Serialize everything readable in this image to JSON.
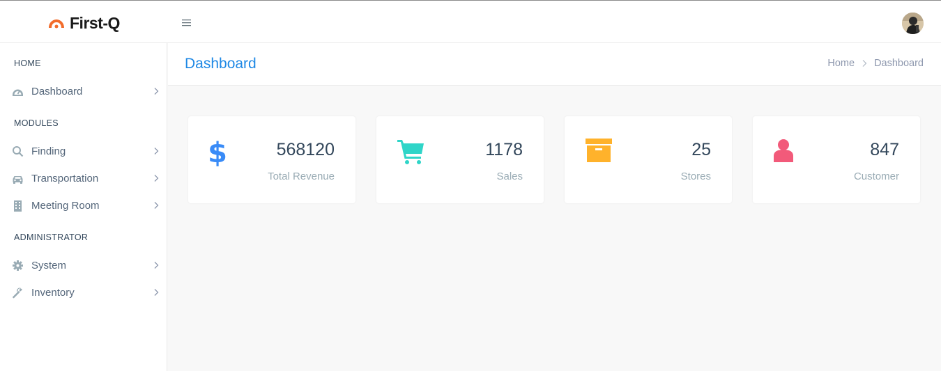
{
  "app": {
    "brand": "First-Q",
    "brand_color": "#f26c2b"
  },
  "topbar": {
    "menu_icon": "hamburger-icon",
    "avatar": "user-avatar"
  },
  "sidebar": {
    "sections": [
      {
        "title": "HOME"
      },
      {
        "title": "MODULES"
      },
      {
        "title": "ADMINISTRATOR"
      }
    ],
    "items": [
      {
        "label": "Dashboard",
        "icon": "gauge-icon"
      },
      {
        "label": "Finding",
        "icon": "search-icon"
      },
      {
        "label": "Transportation",
        "icon": "car-icon"
      },
      {
        "label": "Meeting Room",
        "icon": "building-icon"
      },
      {
        "label": "System",
        "icon": "gear-icon"
      },
      {
        "label": "Inventory",
        "icon": "wrench-icon"
      }
    ]
  },
  "page": {
    "title": "Dashboard",
    "breadcrumb": [
      "Home",
      "Dashboard"
    ]
  },
  "cards": [
    {
      "value": "568120",
      "label": "Total Revenue",
      "icon": "dollar-icon",
      "color": "#398bf7"
    },
    {
      "value": "1178",
      "label": "Sales",
      "icon": "cart-icon",
      "color": "#06d79c"
    },
    {
      "value": "25",
      "label": "Stores",
      "icon": "archive-icon",
      "color": "#ffb22b"
    },
    {
      "value": "847",
      "label": "Customer",
      "icon": "user-icon",
      "color": "#ef5370"
    }
  ]
}
